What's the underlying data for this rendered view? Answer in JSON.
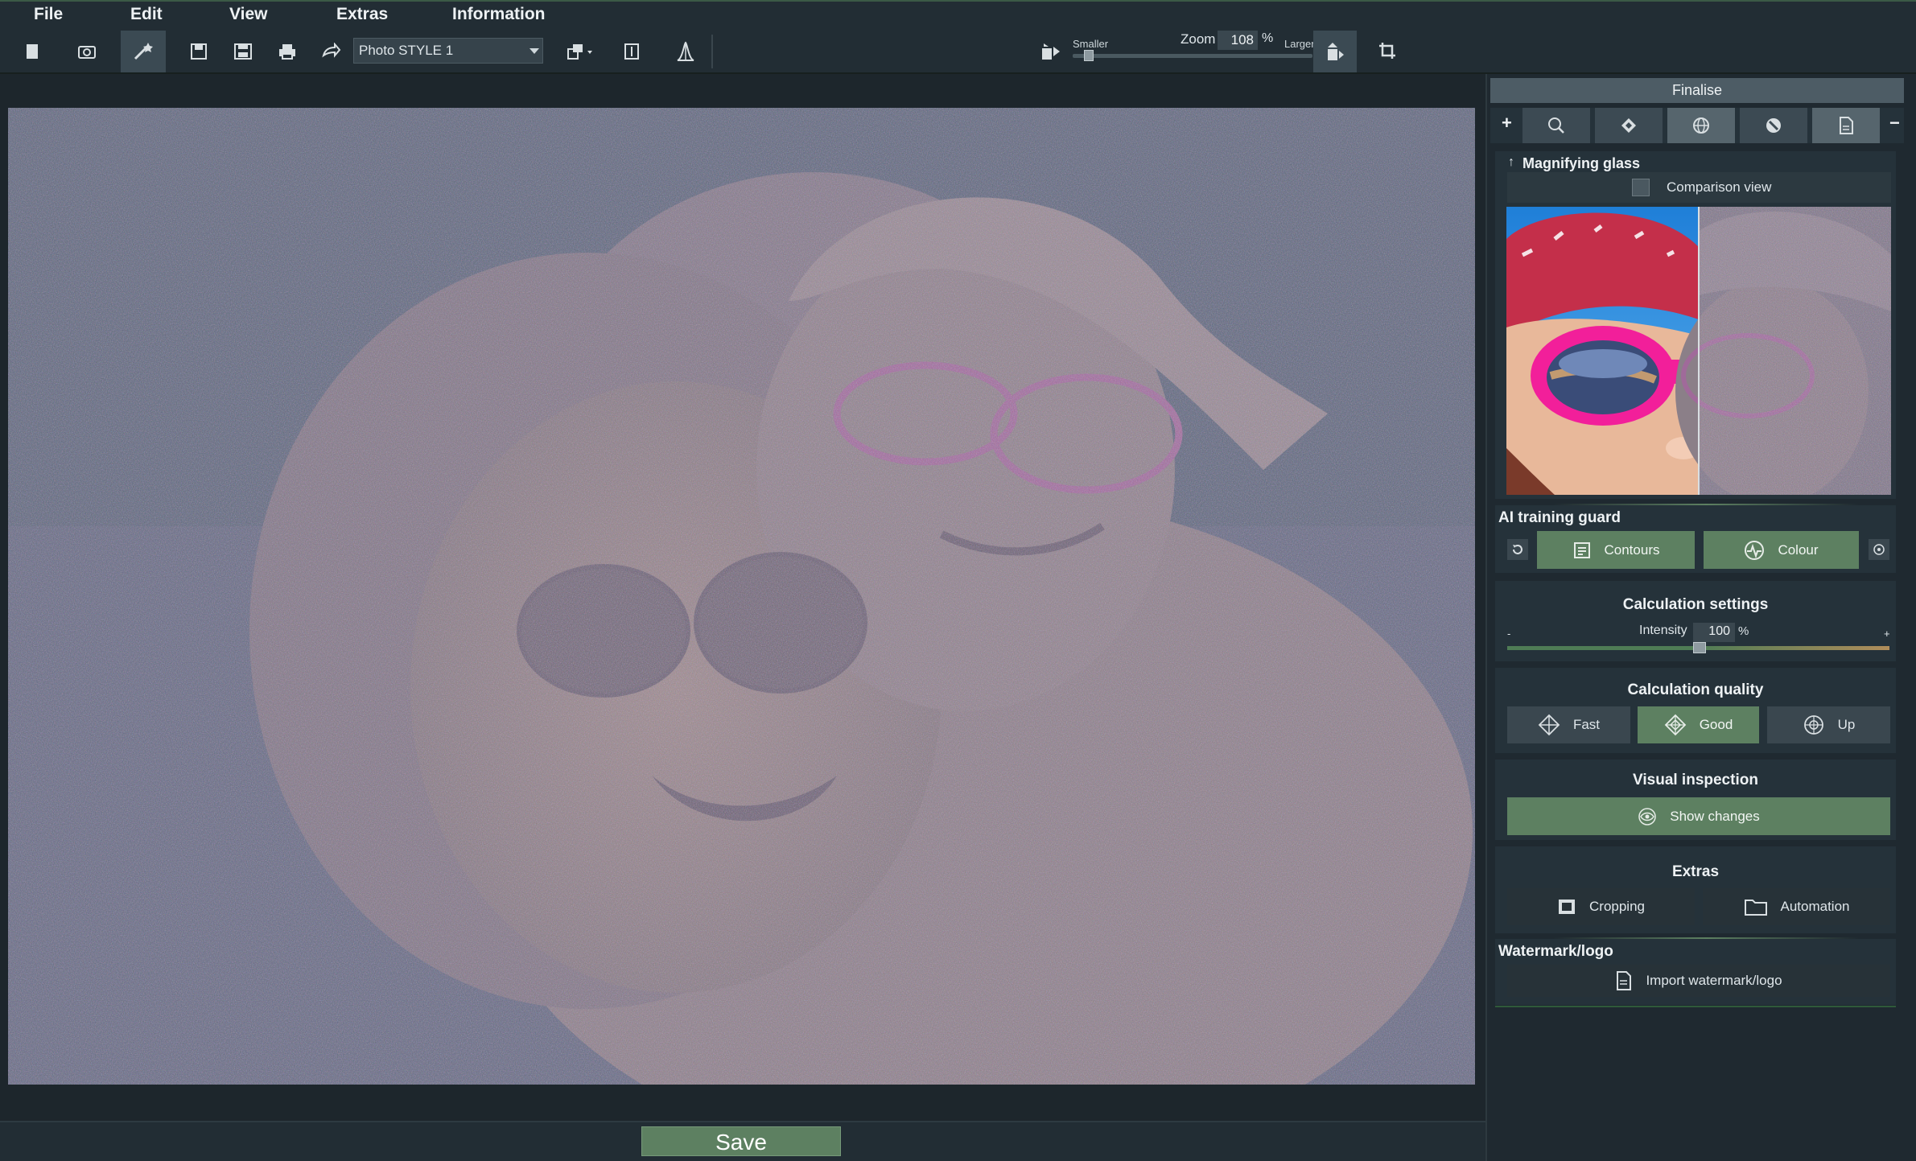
{
  "menu": {
    "file": "File",
    "edit": "Edit",
    "view": "View",
    "extras": "Extras",
    "information": "Information"
  },
  "toolbar": {
    "style_select_value": "Photo STYLE 1",
    "zoom_smaller": "Smaller",
    "zoom_label": "Zoom",
    "zoom_value": "108",
    "zoom_unit": "%",
    "zoom_larger": "Larger",
    "zoom_level": 0.05,
    "icons": [
      "new-document-icon",
      "camera-icon",
      "magic-wand-icon",
      "save-icon",
      "save-all-icon",
      "print-icon",
      "share-icon",
      "batch-icon",
      "text-icon",
      "histogram-icon",
      "compare-icon",
      "zoom-fit-icon",
      "crop-rotate-icon"
    ]
  },
  "main": {
    "save_label": "Save"
  },
  "panel": {
    "header": "Finalise",
    "plus": "+",
    "minus": "−",
    "tabs": [
      "search-icon",
      "diamond-icon",
      "globe-icon",
      "brush-icon",
      "document-icon"
    ],
    "magnifier": {
      "title": "Magnifying glass",
      "comparison": "Comparison view"
    },
    "ai_guard": {
      "title": "AI training guard",
      "contours": "Contours",
      "colour": "Colour"
    },
    "calc_settings": {
      "title": "Calculation settings",
      "intensity_label": "Intensity",
      "intensity_value": "100",
      "intensity_unit": "%",
      "minus": "-",
      "plus": "+"
    },
    "calc_quality": {
      "title": "Calculation quality",
      "fast": "Fast",
      "good": "Good",
      "up": "Up"
    },
    "visual": {
      "title": "Visual inspection",
      "show_changes": "Show changes"
    },
    "extras": {
      "title": "Extras",
      "cropping": "Cropping",
      "automation": "Automation"
    },
    "watermark": {
      "title": "Watermark/logo",
      "import": "Import watermark/logo"
    }
  },
  "colors": {
    "accent_green": "#5d8061",
    "panel_bg": "#25323a",
    "toolbar_bg": "#222d34"
  }
}
